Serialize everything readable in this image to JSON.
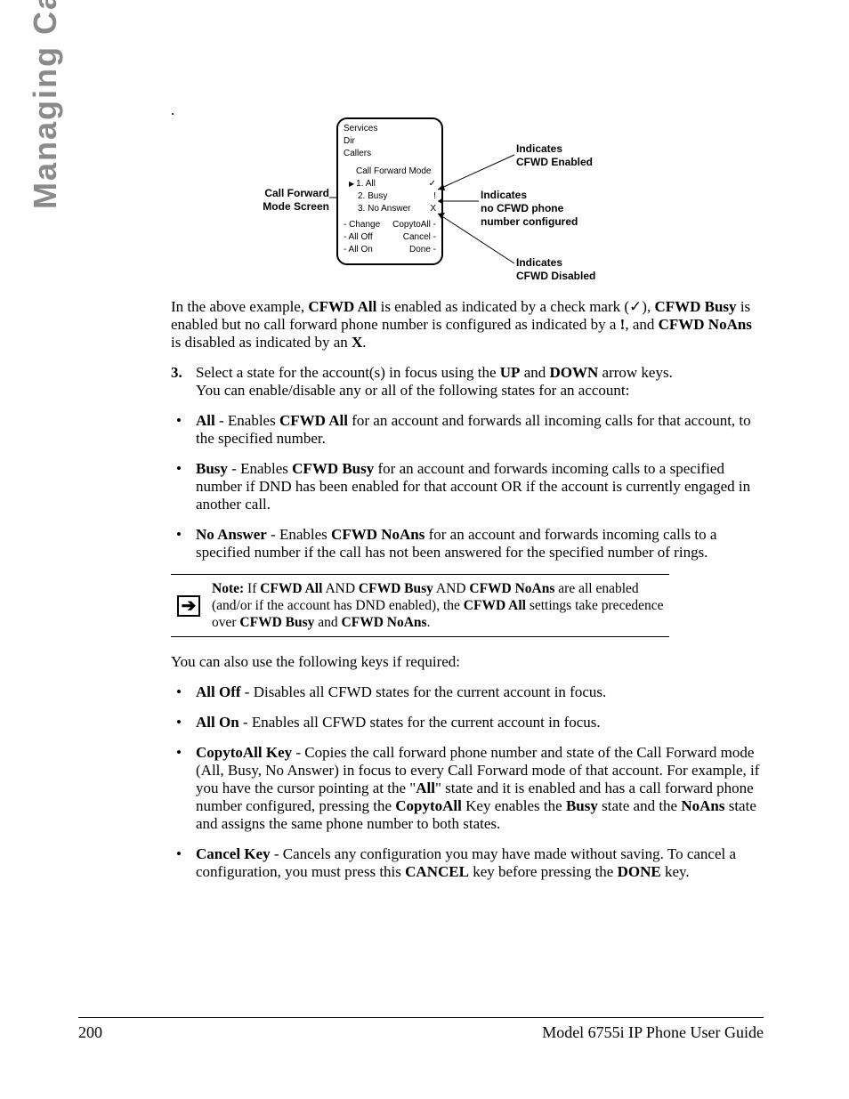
{
  "sideTitle": "Managing Calls",
  "topDot": ".",
  "diagram": {
    "leftLabel": "Call Forward\nMode Screen",
    "screen": {
      "l1": "Services",
      "l2": "Dir",
      "l3": "Callers",
      "heading": "Call Forward Mode",
      "opt1": "1. All",
      "opt1mark": "✓",
      "opt2": "2. Busy",
      "opt2mark": "!",
      "opt3": "3. No Answer",
      "opt3mark": "X",
      "bL1": "- Change",
      "bR1": "CopytoAll -",
      "bL2": "- All Off",
      "bR2": "Cancel -",
      "bL3": "- All On",
      "bR3": "Done -"
    },
    "r1": "Indicates\nCFWD Enabled",
    "r2": "Indicates\nno CFWD phone\nnumber configured",
    "r3": "Indicates\nCFWD Disabled"
  },
  "para1": {
    "t1": "In the above example, ",
    "b1": "CFWD All",
    "t2": " is enabled as indicated by a check mark (",
    "chk": "✓",
    "t3": "), ",
    "b2": "CFWD Busy",
    "t4": " is enabled but no call forward phone number is configured as indicated by a ",
    "b3": "!",
    "t5": ", and ",
    "b4": "CFWD NoAns",
    "t6": " is disabled as indicated by an ",
    "b5": "X",
    "t7": "."
  },
  "step3": {
    "num": "3.",
    "t1": "Select a state for the account(s) in focus using the ",
    "b1": "UP",
    "t2": " and ",
    "b2": "DOWN",
    "t3": " arrow keys.",
    "t4": "You can enable/disable any or all of the following states for an account:"
  },
  "bulA": {
    "all": {
      "b1": "All",
      "t1": " - Enables ",
      "b2": "CFWD All",
      "t2": " for an account and forwards all incoming calls for that account, to the specified number."
    },
    "busy": {
      "b1": "Busy",
      "t1": " - Enables ",
      "b2": "CFWD Busy",
      "t2": " for an account and forwards incoming calls to a specified number if DND has been enabled for that account OR if the account is currently engaged in another call."
    },
    "noans": {
      "b1": "No Answer",
      "t1": " - Enables ",
      "b2": "CFWD NoAns",
      "t2": " for an account and forwards incoming calls to a specified number if the call has not been answered for the specified number of rings."
    }
  },
  "note": {
    "b0": "Note:",
    "t1": " If ",
    "b1": "CFWD All",
    "t2": " AND ",
    "b2": "CFWD Busy",
    "t3": " AND ",
    "b3": "CFWD NoAns",
    "t4": " are all enabled (and/or if the account has DND enabled), the ",
    "b4": "CFWD All",
    "t5": " settings take precedence over ",
    "b5": "CFWD Busy",
    "t6": " and ",
    "b6": "CFWD NoAns",
    "t7": "."
  },
  "para2": "You can also use the following keys if required:",
  "bulB": {
    "alloff": {
      "b1": "All Off",
      "t1": " - Disables all CFWD states for the current account in focus."
    },
    "allon": {
      "b1": "All On",
      "t1": " - Enables all CFWD states for the current account in focus."
    },
    "copy": {
      "b1": "CopytoAll Key",
      "t1": " - Copies the call forward phone number and state of the Call Forward mode (All, Busy, No Answer) in focus to every Call Forward mode of that account. For example, if you have the cursor pointing at the \"",
      "b2": "All",
      "t2": "\" state and it is enabled and has a call forward phone number configured, pressing the ",
      "b3": "CopytoAll",
      "t3": " Key enables the ",
      "b4": "Busy",
      "t4": " state and the ",
      "b5": "NoAns",
      "t5": " state and assigns the same phone number to both states."
    },
    "cancel": {
      "b1": "Cancel Key",
      "t1": " - Cancels any configuration you may have made without saving. To cancel a configuration, you must press this ",
      "b2": "CANCEL",
      "t2": " key before pressing the ",
      "b3": "DONE",
      "t3": " key."
    }
  },
  "footer": {
    "page": "200",
    "title": "Model 6755i IP Phone User Guide"
  }
}
